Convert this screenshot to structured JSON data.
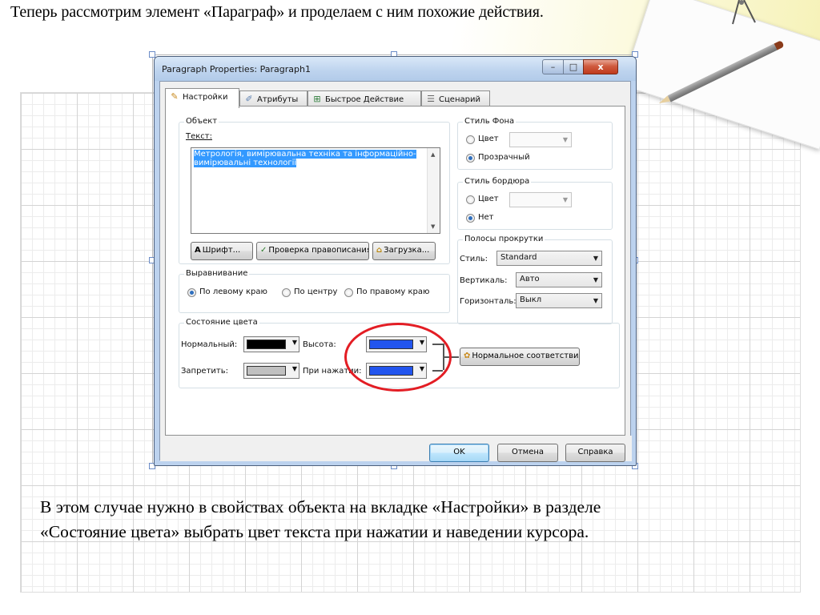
{
  "slide": {
    "heading": "Теперь рассмотрим элемент «Параграф» и проделаем с ним похожие действия.",
    "body_lines": [
      "В этом случае нужно в свойствах объекта на вкладке «Настройки» в разделе",
      "«Состояние цвета» выбрать цвет текста при нажатии и наведении курсора."
    ]
  },
  "dialog": {
    "title": "Paragraph Properties: Paragraph1",
    "window_buttons": {
      "minimize": "–",
      "maximize": "□",
      "close": "x"
    },
    "tabs": [
      {
        "label": "Настройки",
        "icon": "pencil-icon",
        "glyph": "✎",
        "active": true
      },
      {
        "label": "Атрибуты",
        "icon": "brush-icon",
        "glyph": "✐",
        "active": false
      },
      {
        "label": "Быстрое Действие",
        "icon": "quick-action-icon",
        "glyph": "⊞",
        "active": false
      },
      {
        "label": "Сценарий",
        "icon": "script-icon",
        "glyph": "☰",
        "active": false
      }
    ],
    "object_group": {
      "legend": "Объект",
      "text_label": "Текст:",
      "text_value": "Метрологія, вимірювальна техніка та інформаційно-вимірювальні технології",
      "buttons": {
        "font": "Шрифт...",
        "spellcheck": "Проверка правописания",
        "load": "Загрузка..."
      }
    },
    "alignment_group": {
      "legend": "Выравнивание",
      "options": [
        "По левому краю",
        "По центру",
        "По правому краю"
      ],
      "selected": "По левому краю"
    },
    "color_state_group": {
      "legend": "Состояние цвета",
      "normal_label": "Нормальный:",
      "disabled_label": "Запретить:",
      "hover_label": "Высота:",
      "pressed_label": "При нажатии:",
      "match_button": "Нормальное соответствие",
      "colors": {
        "normal": "#000000",
        "disabled": "#c0c0c0",
        "hover": "#2255ee",
        "pressed": "#2255ee"
      }
    },
    "background_style": {
      "legend": "Стиль Фона",
      "options": [
        "Цвет",
        "Прозрачный"
      ],
      "selected": "Прозрачный"
    },
    "border_style": {
      "legend": "Стиль бордюра",
      "options": [
        "Цвет",
        "Нет"
      ],
      "selected": "Нет"
    },
    "scrollbars": {
      "legend": "Полосы прокрутки",
      "style_label": "Стиль:",
      "style_value": "Standard",
      "vertical_label": "Вертикаль:",
      "vertical_value": "Авто",
      "horizontal_label": "Горизонталь:",
      "horizontal_value": "Выкл"
    },
    "footer": {
      "ok": "OK",
      "cancel": "Отмена",
      "help": "Справка"
    }
  }
}
